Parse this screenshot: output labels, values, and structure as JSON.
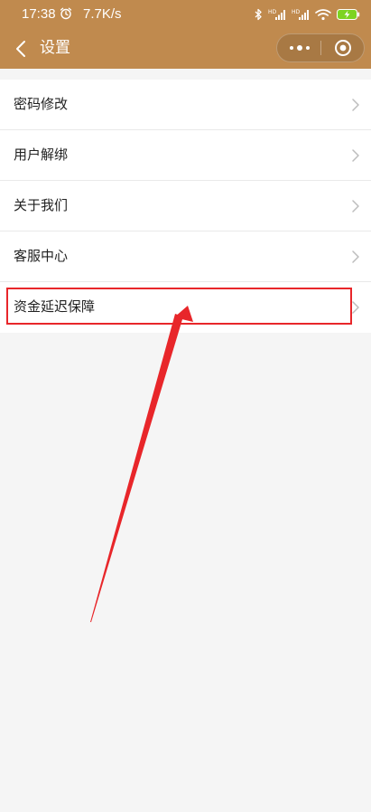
{
  "status_bar": {
    "time": "17:38",
    "net_speed": "7.7K/s",
    "icons": [
      "alarm-icon",
      "bluetooth-icon",
      "signal-hd-icon",
      "signal-hd-icon",
      "wifi-icon",
      "battery-charging-icon"
    ],
    "battery_color": "#7ed321"
  },
  "nav_bar": {
    "title": "设置",
    "background": "#c08a4e",
    "back_icon": "chevron-left-icon",
    "more_icon": "more-dots-icon",
    "close_icon": "target-close-icon"
  },
  "settings": {
    "items": [
      {
        "label": "密码修改"
      },
      {
        "label": "用户解绑"
      },
      {
        "label": "关于我们"
      },
      {
        "label": "客服中心"
      },
      {
        "label": "资金延迟保障"
      }
    ]
  },
  "annotation": {
    "color": "#e8262a",
    "highlighted_item": "资金延迟保障"
  }
}
